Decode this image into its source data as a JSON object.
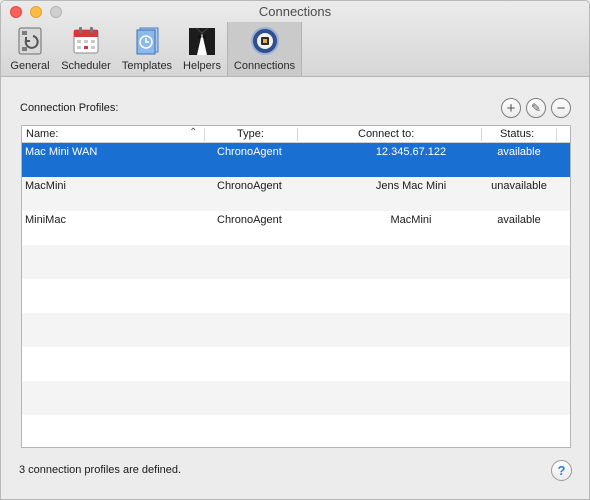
{
  "window": {
    "title": "Connections"
  },
  "toolbar": {
    "items": [
      {
        "label": "General",
        "icon": "general-switch-icon"
      },
      {
        "label": "Scheduler",
        "icon": "calendar-icon"
      },
      {
        "label": "Templates",
        "icon": "templates-icon"
      },
      {
        "label": "Helpers",
        "icon": "butler-icon"
      },
      {
        "label": "Connections",
        "icon": "connections-icon",
        "selected": true
      }
    ]
  },
  "profiles": {
    "label": "Connection Profiles:",
    "add_symbol": "+",
    "edit_symbol": "✎",
    "remove_symbol": "−",
    "columns": {
      "name": "Name:",
      "type": "Type:",
      "connect": "Connect to:",
      "status": "Status:"
    },
    "sort_indicator": "⌃",
    "rows": [
      {
        "name": "Mac Mini WAN",
        "type": "ChronoAgent",
        "connect": "12.345.67.122",
        "status": "available",
        "selected": true
      },
      {
        "name": "MacMini",
        "type": "ChronoAgent",
        "connect": "Jens Mac Mini",
        "status": "unavailable"
      },
      {
        "name": "MiniMac",
        "type": "ChronoAgent",
        "connect": "MacMini",
        "status": "available"
      }
    ]
  },
  "footer": {
    "summary": "3 connection profiles are defined.",
    "help_symbol": "?"
  },
  "colors": {
    "selection": "#1a6fd2",
    "help_accent": "#2d7fe0"
  }
}
